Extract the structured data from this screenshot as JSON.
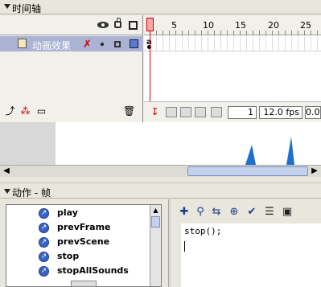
{
  "timeline": {
    "title": "时间轴",
    "ruler_numbers": [
      "1",
      "5",
      "10",
      "15",
      "20",
      "25"
    ],
    "layers": [
      {
        "name": "动画效果"
      }
    ],
    "current_frame": "1",
    "frame_rate": "12.0 fps",
    "elapsed": "0.0s"
  },
  "actions_panel": {
    "title": "动作 - 帧",
    "items": [
      {
        "label": "play"
      },
      {
        "label": "prevFrame"
      },
      {
        "label": "prevScene"
      },
      {
        "label": "stop"
      },
      {
        "label": "stopAllSounds"
      }
    ],
    "code": "stop();"
  },
  "colors": {
    "layer_highlight": "#aab3d3",
    "playhead": "#d00000",
    "action_icon": "#3b63c4",
    "stage_shape": "#1f6fd0"
  }
}
